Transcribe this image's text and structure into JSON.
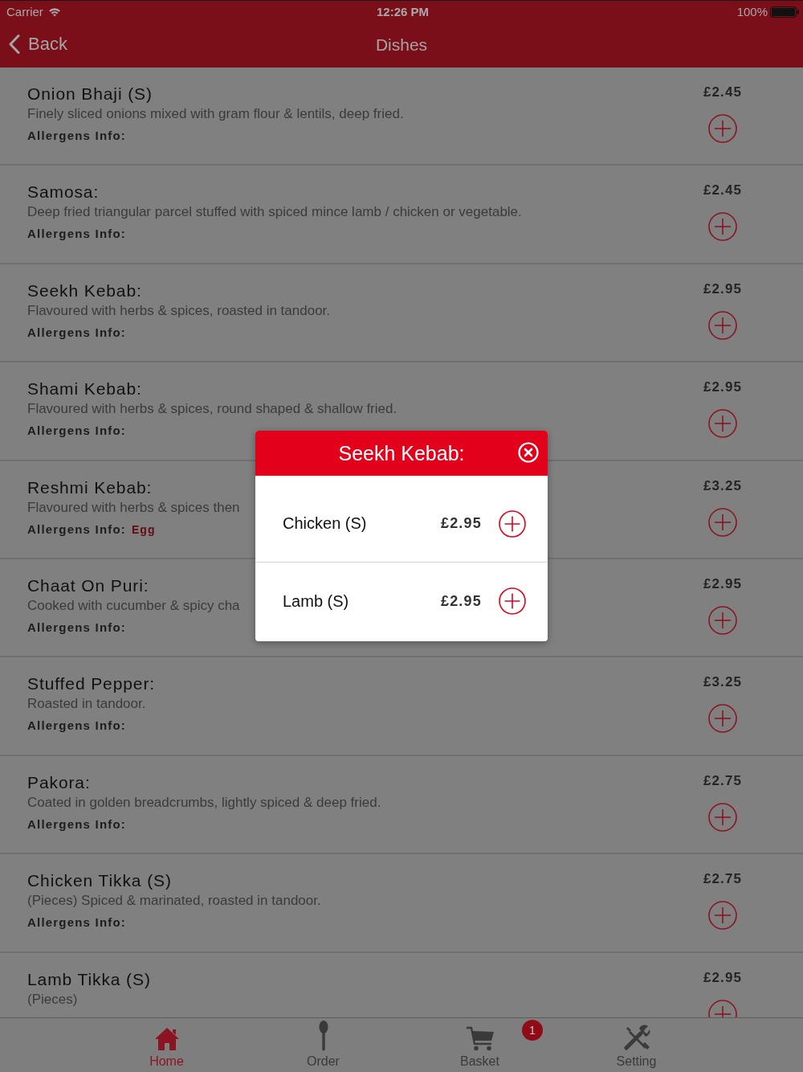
{
  "status_bar": {
    "carrier": "Carrier",
    "time": "12:26 PM",
    "battery": "100%"
  },
  "nav_bar": {
    "back": "Back",
    "title": "Dishes"
  },
  "dishes": [
    {
      "name": "Onion Bhaji (S)",
      "description": "Finely sliced onions mixed with gram flour & lentils, deep fried.",
      "allergens_label": "Allergens Info:",
      "price": "£2.45"
    },
    {
      "name": "Samosa:",
      "description": "Deep fried triangular parcel stuffed with spiced mince lamb / chicken or vegetable.",
      "allergens_label": "Allergens Info:",
      "price": "£2.45"
    },
    {
      "name": "Seekh Kebab:",
      "description": "Flavoured with herbs & spices, roasted in tandoor.",
      "allergens_label": "Allergens Info:",
      "price": "£2.95"
    },
    {
      "name": "Shami Kebab:",
      "description": "Flavoured with herbs & spices, round shaped & shallow fried.",
      "allergens_label": "Allergens Info:",
      "price": "£2.95"
    },
    {
      "name": "Reshmi Kebab:",
      "description": "Flavoured with herbs & spices then",
      "allergens_label": "Allergens Info:",
      "allergens": "Egg",
      "price": "£3.25"
    },
    {
      "name": "Chaat On Puri:",
      "description": "Cooked with cucumber & spicy cha",
      "allergens_label": "Allergens Info:",
      "price": "£2.95"
    },
    {
      "name": "Stuffed Pepper:",
      "description": "Roasted in tandoor.",
      "allergens_label": "Allergens Info:",
      "price": "£3.25"
    },
    {
      "name": "Pakora:",
      "description": "Coated in golden breadcrumbs, lightly spiced & deep fried.",
      "allergens_label": "Allergens Info:",
      "price": "£2.75"
    },
    {
      "name": "Chicken Tikka (S)",
      "description": "(Pieces) Spiced & marinated, roasted in tandoor.",
      "allergens_label": "Allergens Info:",
      "price": "£2.75"
    },
    {
      "name": "Lamb Tikka (S)",
      "description": "(Pieces)",
      "price": "£2.95"
    }
  ],
  "popup": {
    "title": "Seekh Kebab:",
    "options": [
      {
        "name": "Chicken (S)",
        "price": "£2.95"
      },
      {
        "name": "Lamb (S)",
        "price": "£2.95"
      }
    ]
  },
  "tab_bar": [
    {
      "label": "Home",
      "selected": true
    },
    {
      "label": "Order",
      "selected": false
    },
    {
      "label": "Basket",
      "selected": false,
      "badge": "1"
    },
    {
      "label": "Setting",
      "selected": false
    }
  ]
}
